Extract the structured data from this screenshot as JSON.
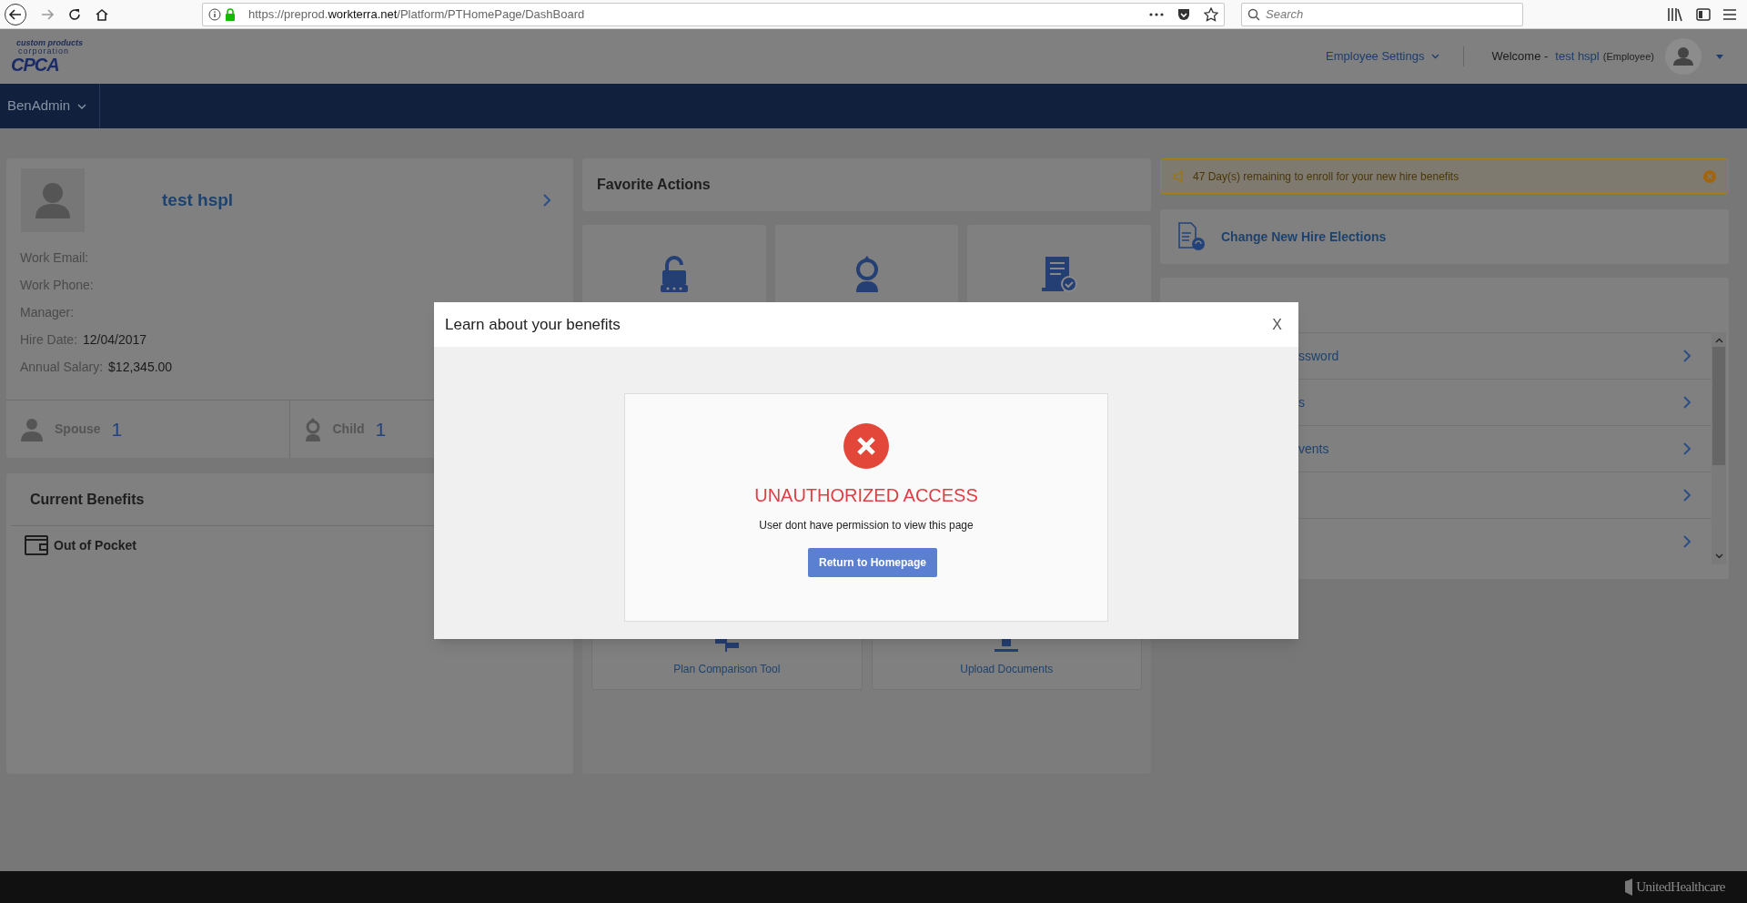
{
  "browser": {
    "url": {
      "prefix": "https://preprod.",
      "domain": "workterra.net",
      "path": "/Platform/PTHomePage/DashBoard"
    },
    "search": {
      "placeholder": "Search"
    }
  },
  "header": {
    "logo": {
      "line_1": "custom products",
      "line_2": "corporation",
      "mark": "CPCA"
    },
    "settings": "Employee Settings",
    "welcome": "Welcome -",
    "user": "test hspl",
    "role": "(Employee)"
  },
  "nav": {
    "menu": "BenAdmin"
  },
  "profile": {
    "name": "test hspl",
    "fields": [
      {
        "label": "Work Email:"
      },
      {
        "label": "Work Phone:"
      },
      {
        "label": "Manager:"
      },
      {
        "label": "Hire Date:",
        "value": "12/04/2017"
      },
      {
        "label": "Annual Salary:",
        "value": "$12,345.00"
      }
    ],
    "dependents": [
      {
        "kind": "adult",
        "label": "Spouse",
        "count": "1"
      },
      {
        "kind": "child",
        "label": "Child",
        "count": "1"
      }
    ]
  },
  "current_benefits": {
    "title": "Current Benefits",
    "items": [
      {
        "label": "Out of Pocket"
      }
    ]
  },
  "favorite_actions": {
    "title": "Favorite Actions",
    "top_tiles": [
      {
        "kind": "lock"
      },
      {
        "kind": "person"
      },
      {
        "kind": "document"
      }
    ],
    "bottom_tiles": [
      {
        "kind": "signpost",
        "label": "Plan Comparison Tool"
      },
      {
        "kind": "upload",
        "label": "Upload Documents"
      }
    ]
  },
  "alert": {
    "text": "47 Day(s) remaining to enroll for your new hire benefits"
  },
  "new_hire": {
    "label": "Change New Hire Elections"
  },
  "quick_links": [
    {
      "kind": "link",
      "label": "ssword"
    },
    {
      "kind": "link",
      "label": "s"
    },
    {
      "kind": "link",
      "label": "vents"
    },
    {
      "kind": "blank"
    },
    {
      "kind": "blank"
    }
  ],
  "modal": {
    "title": "Learn about your benefits",
    "close": "X",
    "error_title": "UNAUTHORIZED ACCESS",
    "message": "User dont have permission to view this page",
    "button": "Return to Homepage"
  },
  "footer": {
    "brand": "UnitedHealthcare"
  }
}
